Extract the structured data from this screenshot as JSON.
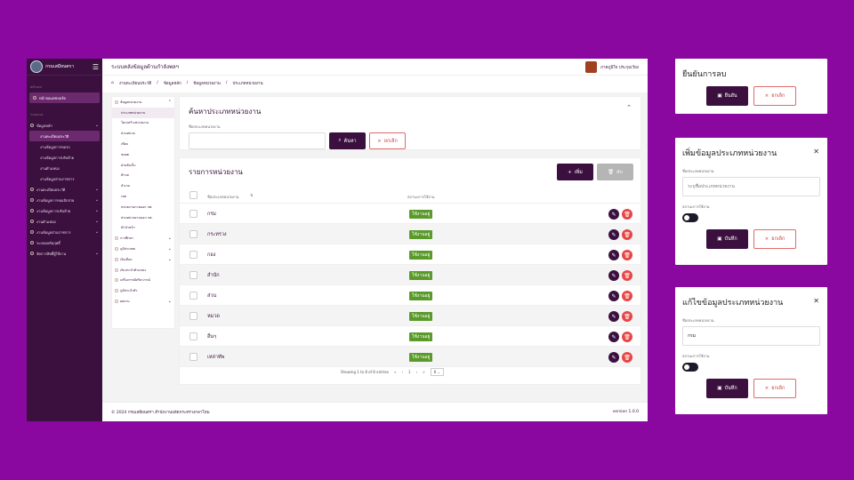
{
  "sidebar": {
    "app_name": "กรมเสมียนตรา",
    "section_main": "หน้าแรก",
    "dashboard": "หน้าจอแดชบอร์ด",
    "section_system": "ระบบงาน",
    "items": [
      {
        "label": "ข้อมูลหลัก"
      },
      {
        "label": "งานทะเบียนประวัติ"
      },
      {
        "label": "งานข้อมูลการขอเบิกจ่าย"
      },
      {
        "label": "งานข้อมูลการปรับย้าย"
      },
      {
        "label": "งานตำแหน่ง"
      },
      {
        "label": "งานข้อมูลส่วนราชการ"
      },
      {
        "label": "ระบบผลสัมฤทธิ์"
      },
      {
        "label": "จัดการสิทธิ์ผู้ใช้งาน"
      }
    ],
    "subitems": [
      {
        "label": "งานทะเบียนประวัติ"
      },
      {
        "label": "งานข้อมูลการขอรถ"
      },
      {
        "label": "งานข้อมูลการปรับย้าย"
      },
      {
        "label": "งานตำแหน่ง"
      },
      {
        "label": "งานข้อมูลส่วนราชการ"
      }
    ]
  },
  "topbar": {
    "title": "ระบบคลังข้อมูลด้านกำลังพลฯ",
    "user": "ภาคภูมิใจ ประกุมเวียง"
  },
  "breadcrumb": [
    "งานทะเบียนประวัติ",
    "ข้อมูลหลัก",
    "ข้อมูลหน่วยงาน",
    "ประเภทหน่วยงาน"
  ],
  "submenu": {
    "group1": "ข้อมูลหน่วยงาน",
    "items": [
      "ประเภทหน่วยงาน",
      "โครงสร้างหน่วยงาน",
      "ส่วนหน่วย",
      "เขียบ",
      "ชอยต",
      "ฝ่ายจัดเก็บ",
      "ตำบล",
      "อำเภอ",
      "เขต",
      "หน่วยงานภายนอก กพ.",
      "ส่วนหน่วยงานนอก กพ.",
      "คำนำหน้า"
    ],
    "groups": [
      "การศึกษา",
      "ภูมิประเทศ",
      "เงินเดือน",
      "เงินประจำตำแหน่ง",
      "เครื่องราชอิสริยาภรณ์",
      "ภูมิประจำตัว",
      "ยศงาน"
    ]
  },
  "search": {
    "title": "ค้นหาประเภทหน่วยงาน",
    "field_label": "ชื่อประเภทหน่วยงาน",
    "btn_search": "ค้นหา",
    "btn_cancel": "ยกเลิก"
  },
  "list": {
    "title": "รายการหน่วยงาน",
    "btn_add": "เพิ่ม",
    "btn_delete": "ลบ",
    "col_name": "ชื่อประเภทหน่วยงาน",
    "col_status": "สถานะการใช้งาน",
    "rows": [
      {
        "name": "กรม",
        "status": "ใช้งานอยู่"
      },
      {
        "name": "กระทรวง",
        "status": "ใช้งานอยู่"
      },
      {
        "name": "กอง",
        "status": "ใช้งานอยู่"
      },
      {
        "name": "สำนัก",
        "status": "ใช้งานอยู่"
      },
      {
        "name": "ส่วน",
        "status": "ใช้งานอยู่"
      },
      {
        "name": "หมวด",
        "status": "ใช้งานอยู่"
      },
      {
        "name": "อื่นๆ",
        "status": "ใช้งานอยู่"
      },
      {
        "name": "เหล่าทัพ",
        "status": "ใช้งานอยู่"
      }
    ],
    "pager_text": "Showing 1 to 8 of 8 entries",
    "page": "1",
    "per_page": "8"
  },
  "footer": {
    "copyright": "© 2024 กรมเสมียนตรา สำนักงานปลัดกระทรวงกลาโหม",
    "version": "version 1.0.0"
  },
  "modal_confirm": {
    "title": "ยืนยันการลบ",
    "btn_ok": "ยืนยัน",
    "btn_cancel": "ยกเลิก"
  },
  "modal_add": {
    "title": "เพิ่มข้อมูลประเภทหน่วยงาน",
    "field_label": "ชื่อประเภทหน่วยงาน",
    "placeholder": "ระบุชื่อประเภทหน่วยงาน",
    "status_label": "สถานะการใช้งาน",
    "btn_save": "บันทึก",
    "btn_cancel": "ยกเลิก"
  },
  "modal_edit": {
    "title": "แก้ไขข้อมูลประเภทหน่วยงาน",
    "field_label": "ชื่อประเภทหน่วยงาน",
    "value": "กรม",
    "status_label": "สถานะการใช้งาน",
    "btn_save": "บันทึก",
    "btn_cancel": "ยกเลิก"
  }
}
